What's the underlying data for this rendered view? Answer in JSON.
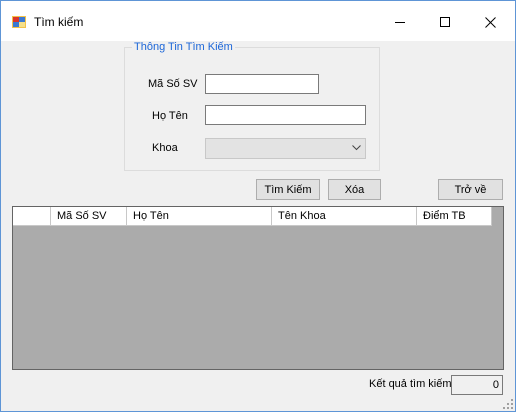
{
  "window": {
    "title": "Tìm kiếm"
  },
  "search_group": {
    "legend": "Thông Tin Tìm Kiếm",
    "student_id_label": "Mã Số SV",
    "student_id_value": "",
    "name_label": "Họ Tên",
    "name_value": "",
    "faculty_label": "Khoa",
    "faculty_value": ""
  },
  "buttons": {
    "search": "Tìm Kiếm",
    "clear": "Xóa",
    "back": "Trở về"
  },
  "table": {
    "columns": [
      "",
      "Mã Số SV",
      "Họ Tên",
      "Tên Khoa",
      "Điểm TB"
    ],
    "rows": []
  },
  "status": {
    "result_label": "Kết quả tìm kiếm",
    "result_count": "0"
  },
  "colors": {
    "legend_text": "#1c66d8",
    "grid_background": "#ababab",
    "window_border": "#5e95d6"
  }
}
